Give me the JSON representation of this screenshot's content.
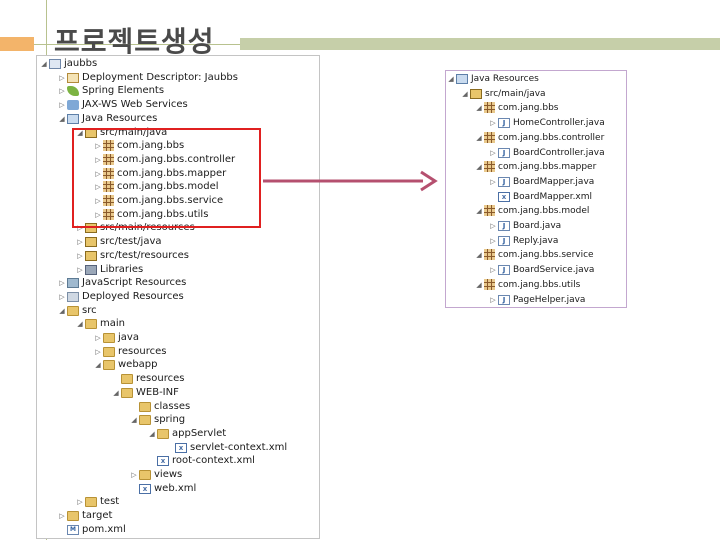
{
  "slide": {
    "title": "프로젝트생성"
  },
  "left_tree": {
    "rows": [
      {
        "label": "jaubbs",
        "depth": 0,
        "twisty": "open",
        "icon": "project-icon"
      },
      {
        "label": "Deployment Descriptor: Jaubbs",
        "depth": 1,
        "twisty": "closed",
        "icon": "descriptor-icon"
      },
      {
        "label": "Spring Elements",
        "depth": 1,
        "twisty": "closed",
        "icon": "spring-icon"
      },
      {
        "label": "JAX-WS Web Services",
        "depth": 1,
        "twisty": "closed",
        "icon": "web-services-icon"
      },
      {
        "label": "Java Resources",
        "depth": 1,
        "twisty": "open",
        "icon": "java-resources-icon"
      },
      {
        "label": "src/main/java",
        "depth": 2,
        "twisty": "open",
        "icon": "source-folder-icon"
      },
      {
        "label": "com.jang.bbs",
        "depth": 3,
        "twisty": "closed",
        "icon": "package-icon"
      },
      {
        "label": "com.jang.bbs.controller",
        "depth": 3,
        "twisty": "closed",
        "icon": "package-icon"
      },
      {
        "label": "com.jang.bbs.mapper",
        "depth": 3,
        "twisty": "closed",
        "icon": "package-icon"
      },
      {
        "label": "com.jang.bbs.model",
        "depth": 3,
        "twisty": "closed",
        "icon": "package-icon"
      },
      {
        "label": "com.jang.bbs.service",
        "depth": 3,
        "twisty": "closed",
        "icon": "package-icon"
      },
      {
        "label": "com.jang.bbs.utils",
        "depth": 3,
        "twisty": "closed",
        "icon": "package-icon"
      },
      {
        "label": "src/main/resources",
        "depth": 2,
        "twisty": "closed",
        "icon": "source-folder-icon"
      },
      {
        "label": "src/test/java",
        "depth": 2,
        "twisty": "closed",
        "icon": "source-folder-icon"
      },
      {
        "label": "src/test/resources",
        "depth": 2,
        "twisty": "closed",
        "icon": "source-folder-icon"
      },
      {
        "label": "Libraries",
        "depth": 2,
        "twisty": "closed",
        "icon": "libraries-icon"
      },
      {
        "label": "JavaScript Resources",
        "depth": 1,
        "twisty": "closed",
        "icon": "javascript-resources-icon"
      },
      {
        "label": "Deployed Resources",
        "depth": 1,
        "twisty": "closed",
        "icon": "deployed-resources-icon"
      },
      {
        "label": "src",
        "depth": 1,
        "twisty": "open",
        "icon": "folder-icon"
      },
      {
        "label": "main",
        "depth": 2,
        "twisty": "open",
        "icon": "folder-icon"
      },
      {
        "label": "java",
        "depth": 3,
        "twisty": "closed",
        "icon": "folder-icon"
      },
      {
        "label": "resources",
        "depth": 3,
        "twisty": "closed",
        "icon": "folder-icon"
      },
      {
        "label": "webapp",
        "depth": 3,
        "twisty": "open",
        "icon": "folder-icon"
      },
      {
        "label": "resources",
        "depth": 4,
        "twisty": "none",
        "icon": "folder-icon"
      },
      {
        "label": "WEB-INF",
        "depth": 4,
        "twisty": "open",
        "icon": "folder-icon"
      },
      {
        "label": "classes",
        "depth": 5,
        "twisty": "none",
        "icon": "folder-icon"
      },
      {
        "label": "spring",
        "depth": 5,
        "twisty": "open",
        "icon": "folder-icon"
      },
      {
        "label": "appServlet",
        "depth": 6,
        "twisty": "open",
        "icon": "folder-icon"
      },
      {
        "label": "servlet-context.xml",
        "depth": 7,
        "twisty": "none",
        "icon": "xml-file-icon"
      },
      {
        "label": "root-context.xml",
        "depth": 6,
        "twisty": "none",
        "icon": "xml-file-icon"
      },
      {
        "label": "views",
        "depth": 5,
        "twisty": "closed",
        "icon": "folder-icon"
      },
      {
        "label": "web.xml",
        "depth": 5,
        "twisty": "none",
        "icon": "xml-file-icon"
      },
      {
        "label": "test",
        "depth": 2,
        "twisty": "closed",
        "icon": "folder-icon"
      },
      {
        "label": "target",
        "depth": 1,
        "twisty": "closed",
        "icon": "folder-icon"
      },
      {
        "label": "pom.xml",
        "depth": 1,
        "twisty": "none",
        "icon": "pom-file-icon"
      }
    ]
  },
  "right_tree": {
    "rows": [
      {
        "label": "Java Resources",
        "depth": 0,
        "twisty": "open",
        "icon": "java-resources-icon"
      },
      {
        "label": "src/main/java",
        "depth": 1,
        "twisty": "open",
        "icon": "source-folder-icon"
      },
      {
        "label": "com.jang.bbs",
        "depth": 2,
        "twisty": "open",
        "icon": "package-icon"
      },
      {
        "label": "HomeController.java",
        "depth": 3,
        "twisty": "closed",
        "icon": "java-file-icon"
      },
      {
        "label": "com.jang.bbs.controller",
        "depth": 2,
        "twisty": "open",
        "icon": "package-icon"
      },
      {
        "label": "BoardController.java",
        "depth": 3,
        "twisty": "closed",
        "icon": "java-file-icon"
      },
      {
        "label": "com.jang.bbs.mapper",
        "depth": 2,
        "twisty": "open",
        "icon": "package-icon"
      },
      {
        "label": "BoardMapper.java",
        "depth": 3,
        "twisty": "closed",
        "icon": "java-file-icon"
      },
      {
        "label": "BoardMapper.xml",
        "depth": 3,
        "twisty": "none",
        "icon": "xml-file-icon"
      },
      {
        "label": "com.jang.bbs.model",
        "depth": 2,
        "twisty": "open",
        "icon": "package-icon"
      },
      {
        "label": "Board.java",
        "depth": 3,
        "twisty": "closed",
        "icon": "java-file-icon"
      },
      {
        "label": "Reply.java",
        "depth": 3,
        "twisty": "closed",
        "icon": "java-file-icon"
      },
      {
        "label": "com.jang.bbs.service",
        "depth": 2,
        "twisty": "open",
        "icon": "package-icon"
      },
      {
        "label": "BoardService.java",
        "depth": 3,
        "twisty": "closed",
        "icon": "java-file-icon"
      },
      {
        "label": "com.jang.bbs.utils",
        "depth": 2,
        "twisty": "open",
        "icon": "package-icon"
      },
      {
        "label": "PageHelper.java",
        "depth": 3,
        "twisty": "closed",
        "icon": "java-file-icon"
      }
    ]
  },
  "colors": {
    "highlight": "#e02020",
    "arrow": "#b5506f",
    "title": "#4a4a4a"
  }
}
